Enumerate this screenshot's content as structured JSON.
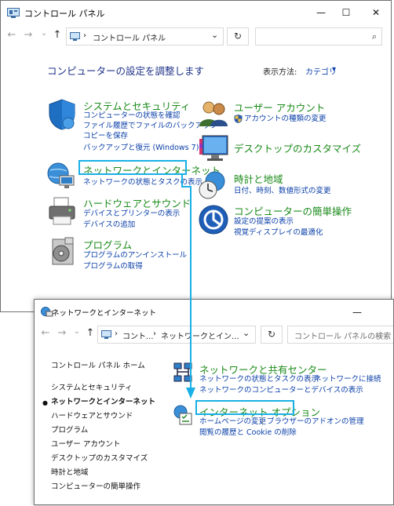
{
  "window1": {
    "title": "コントロール パネル",
    "controls": {
      "minimize": "—",
      "maximize": "☐",
      "close": "✕"
    },
    "address": {
      "back": "←",
      "forward": "→",
      "recent": "⌄",
      "up": "↑",
      "separator": "›",
      "crumb": "コントロール パネル",
      "dropdown": "⌄",
      "refresh": "↻"
    },
    "search": {
      "icon": "search-icon"
    },
    "heading": "コンピューターの設定を調整します",
    "view_by": {
      "label": "表示方法:",
      "value": "カテゴリ",
      "caret": "▾"
    },
    "categories": [
      {
        "title": "システムとセキュリティ",
        "links": [
          "コンピューターの状態を確認",
          "ファイル履歴でファイルのバックアップ",
          "コピーを保存",
          "バックアップと復元 (Windows 7)"
        ]
      },
      {
        "title": "ネットワークとインターネット",
        "links": [
          "ネットワークの状態とタスクの表示"
        ]
      },
      {
        "title": "ハードウェアとサウンド",
        "links": [
          "デバイスとプリンターの表示",
          "デバイスの追加"
        ]
      },
      {
        "title": "プログラム",
        "links": [
          "プログラムのアンインストール",
          "プログラムの取得"
        ]
      },
      {
        "title": "ユーザー アカウント",
        "links": [
          "アカウントの種類の変更"
        ]
      },
      {
        "title": "デスクトップのカスタマイズ",
        "links": []
      },
      {
        "title": "時計と地域",
        "links": [
          "日付、時刻、数値形式の変更"
        ]
      },
      {
        "title": "コンピューターの簡単操作",
        "links": [
          "設定の提案の表示",
          "視覚ディスプレイの最適化"
        ]
      }
    ]
  },
  "window2": {
    "title": "ネットワークとインターネット",
    "controls": {
      "minimize": "—"
    },
    "address": {
      "back": "←",
      "forward": "→",
      "recent": "⌄",
      "up": "↑",
      "sep": "›",
      "crumb1": "コント...",
      "crumb2": "ネットワークとイン...",
      "dropdown": "⌄",
      "refresh": "↻"
    },
    "search": {
      "placeholder": "コントロール パネルの検索"
    },
    "sidebar": [
      "コントロール パネル ホーム",
      "システムとセキュリティ",
      "ネットワークとインターネット",
      "ハードウェアとサウンド",
      "プログラム",
      "ユーザー アカウント",
      "デスクトップのカスタマイズ",
      "時計と地域",
      "コンピューターの簡単操作"
    ],
    "bullet": "●",
    "sections": [
      {
        "title": "ネットワークと共有センター",
        "links": [
          "ネットワークの状態とタスクの表示",
          "ネットワークに接続",
          "ネットワークのコンピューターとデバイスの表示"
        ],
        "sep": "|"
      },
      {
        "title": "インターネット オプション",
        "links": [
          "ホームページの変更",
          "ブラウザーのアドオンの管理",
          "閲覧の履歴と Cookie の削除"
        ],
        "sep": "|"
      }
    ]
  },
  "colors": {
    "highlight": "#19b0e6",
    "link": "#0a3fa8",
    "category": "#1a8a1a",
    "heading": "#1e3287"
  }
}
